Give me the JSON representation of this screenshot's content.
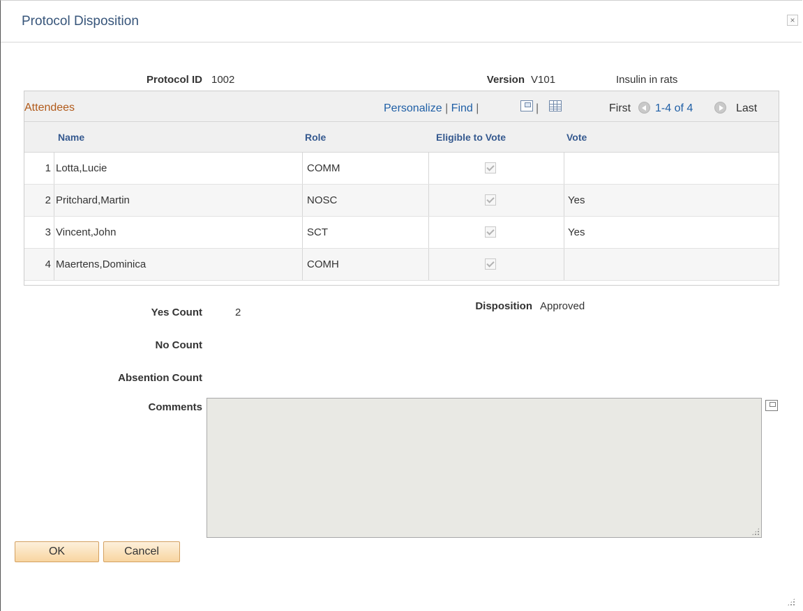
{
  "dialog": {
    "title": "Protocol Disposition",
    "close_label": "×"
  },
  "protocol": {
    "id_label": "Protocol ID",
    "id_value": "1002",
    "version_label": "Version",
    "version_value": "V101",
    "description": "Insulin in rats"
  },
  "attendees": {
    "title": "Attendees",
    "personalize": "Personalize",
    "separator": "|",
    "find": "Find",
    "first": "First",
    "range": "1-4 of 4",
    "last": "Last",
    "columns": {
      "name": "Name",
      "role": "Role",
      "eligible": "Eligible to Vote",
      "vote": "Vote"
    },
    "rows": [
      {
        "num": "1",
        "name": "Lotta,Lucie",
        "role": "COMM",
        "eligible": true,
        "vote": ""
      },
      {
        "num": "2",
        "name": "Pritchard,Martin",
        "role": "NOSC",
        "eligible": true,
        "vote": "Yes"
      },
      {
        "num": "3",
        "name": "Vincent,John",
        "role": "SCT",
        "eligible": true,
        "vote": "Yes"
      },
      {
        "num": "4",
        "name": "Maertens,Dominica",
        "role": "COMH",
        "eligible": true,
        "vote": ""
      }
    ]
  },
  "summary": {
    "yes_label": "Yes Count",
    "yes_value": "2",
    "no_label": "No Count",
    "no_value": "",
    "abstention_label": "Absention Count",
    "abstention_value": "",
    "disposition_label": "Disposition",
    "disposition_value": "Approved",
    "comments_label": "Comments",
    "comments_value": ""
  },
  "buttons": {
    "ok": "OK",
    "cancel": "Cancel"
  },
  "colors": {
    "title": "#37557a",
    "grid_title": "#b15a1a",
    "link": "#1f5fa6",
    "button_border": "#d3a060"
  },
  "icons": [
    "close-icon",
    "popout-icon",
    "download-grid-icon",
    "previous-icon",
    "next-icon",
    "expand-icon",
    "resize-grip-icon"
  ]
}
